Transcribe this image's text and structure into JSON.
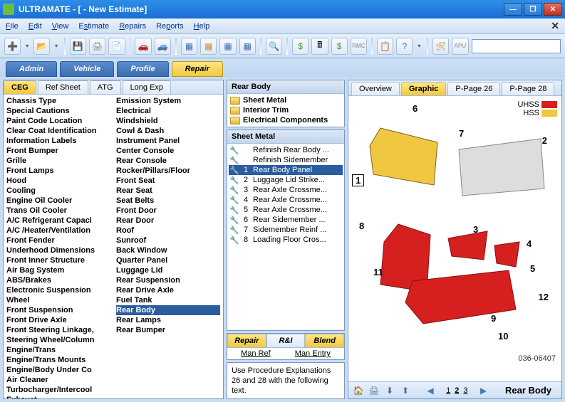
{
  "window": {
    "title": "ULTRAMATE - [ - New Estimate]"
  },
  "menu": {
    "file": "File",
    "edit": "Edit",
    "view": "View",
    "estimate": "Estimate",
    "repairs": "Repairs",
    "reports": "Reports",
    "help": "Help"
  },
  "primary_tabs": {
    "admin": "Admin",
    "vehicle": "Vehicle",
    "profile": "Profile",
    "repair": "Repair"
  },
  "sub_tabs": {
    "ceg": "CEG",
    "ref": "Ref Sheet",
    "atg": "ATG",
    "longexp": "Long Exp"
  },
  "categories_col1": [
    "Chassis Type",
    "Special Cautions",
    "Paint Code Location",
    "Clear Coat Identification",
    "Information Labels",
    "Front Bumper",
    "Grille",
    "Front Lamps",
    "Hood",
    "Cooling",
    "Engine Oil Cooler",
    "Trans Oil Cooler",
    "A/C Refrigerant Capaci",
    "A/C /Heater/Ventilation",
    "Front Fender",
    "Underhood Dimensions",
    "Front Inner Structure",
    "Air Bag System",
    "ABS/Brakes",
    "Electronic Suspension",
    "Wheel",
    "Front Suspension",
    "Front Drive Axle",
    "Front Steering Linkage,",
    "Steering Wheel/Column",
    "Engine/Trans",
    "Engine/Trans Mounts",
    "Engine/Body Under Co",
    "Air Cleaner",
    "Turbocharger/Intercool",
    "Exhaust"
  ],
  "categories_col2": [
    "Emission System",
    "Electrical",
    "Windshield",
    "Cowl & Dash",
    "Instrument Panel",
    "Center Console",
    "Rear Console",
    "Rocker/Pillars/Floor",
    "Front Seat",
    "Rear Seat",
    "Seat Belts",
    "Front Door",
    "Rear Door",
    "Roof",
    "Sunroof",
    "Back Window",
    "Quarter Panel",
    "Luggage Lid",
    "Rear Suspension",
    "Rear Drive Axle",
    "Fuel Tank",
    "Rear Body",
    "Rear Lamps",
    "Rear Bumper"
  ],
  "selected_category": "Rear Body",
  "mid": {
    "header": "Rear Body",
    "folders": [
      "Sheet Metal",
      "Interior Trim",
      "Electrical Components"
    ],
    "parts_header": "Sheet Metal",
    "parts": [
      {
        "n": "",
        "t": "Refinish Rear Body ..."
      },
      {
        "n": "",
        "t": "Refinish Sidemember"
      },
      {
        "n": "1",
        "t": "Rear Body Panel",
        "sel": true
      },
      {
        "n": "2",
        "t": "Luggage Lid Strike..."
      },
      {
        "n": "3",
        "t": "Rear Axle Crossme..."
      },
      {
        "n": "4",
        "t": "Rear Axle Crossme..."
      },
      {
        "n": "5",
        "t": "Rear Axle Crossme..."
      },
      {
        "n": "6",
        "t": "Rear Sidemember ..."
      },
      {
        "n": "7",
        "t": "Sidemember Reinf ..."
      },
      {
        "n": "8",
        "t": "Loading Floor Cros..."
      }
    ],
    "actions": {
      "repair": "Repair",
      "ri": "R&I",
      "blend": "Blend",
      "manref": "Man Ref",
      "manentry": "Man Entry"
    },
    "procedure": "Use Procedure Explanations 26 and 28 with the following text."
  },
  "right_tabs": {
    "overview": "Overview",
    "graphic": "Graphic",
    "p26": "P-Page 26",
    "p28": "P-Page 28"
  },
  "legend": {
    "uhss": "UHSS",
    "hss": "HSS"
  },
  "image_id": "036-06407",
  "nav": {
    "pages": [
      "1",
      "2",
      "3"
    ],
    "title": "Rear Body"
  }
}
